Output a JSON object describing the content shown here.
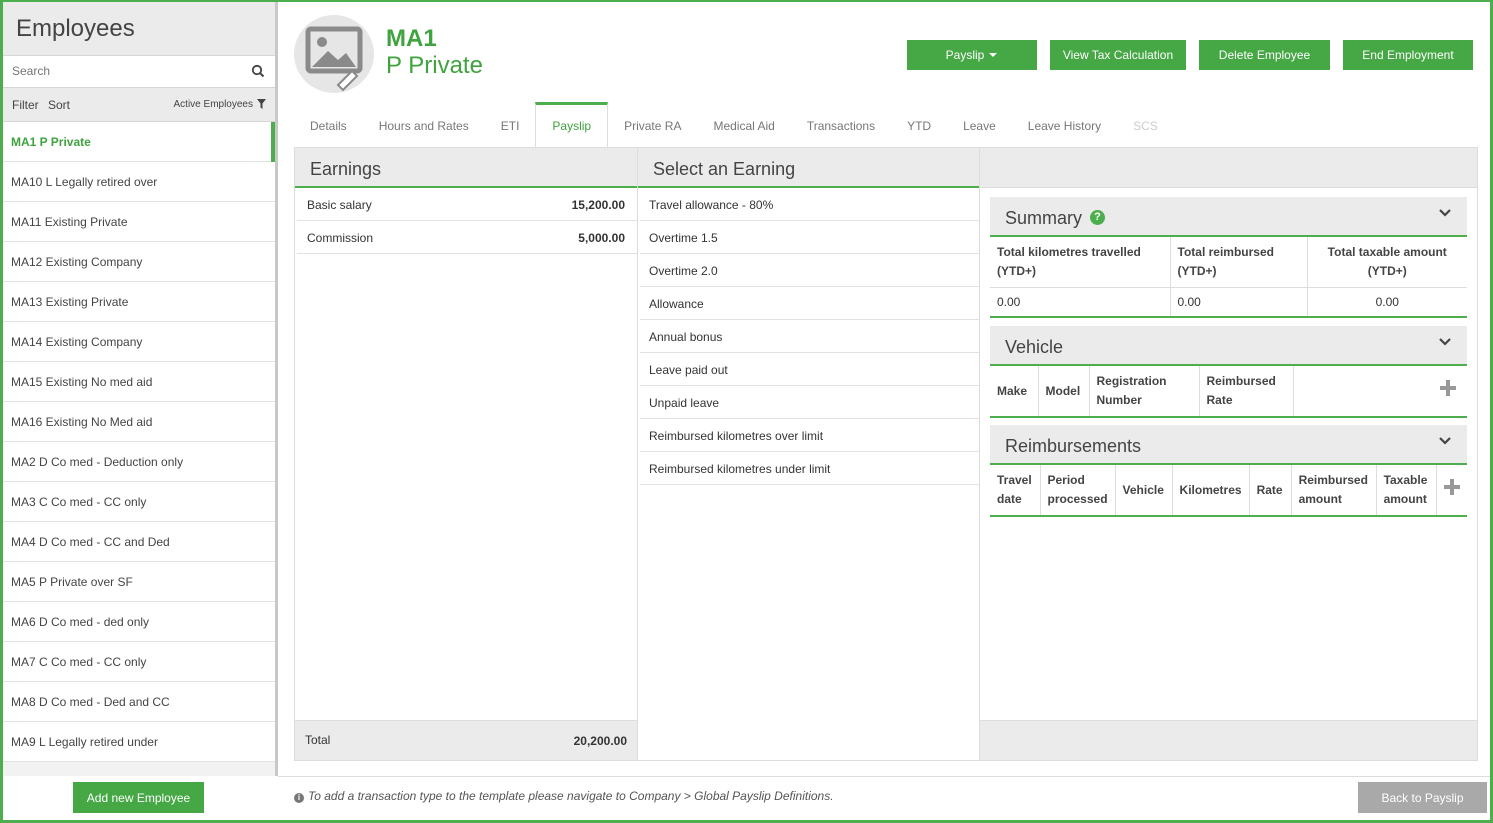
{
  "sidebar": {
    "title": "Employees",
    "search_placeholder": "Search",
    "filter_label": "Filter",
    "sort_label": "Sort",
    "active_filter": "Active Employees",
    "employees": [
      "MA1 P Private",
      "MA10 L Legally retired over",
      "MA11 Existing Private",
      "MA12 Existing Company",
      "MA13 Existing Private",
      "MA14 Existing Company",
      "MA15 Existing No med aid",
      "MA16 Existing No Med aid",
      "MA2 D Co med - Deduction only",
      "MA3 C Co med - CC only",
      "MA4 D Co med - CC and Ded",
      "MA5 P Private over SF",
      "MA6 D Co med - ded only",
      "MA7 C Co med - CC only",
      "MA8 D Co med - Ded and CC",
      "MA9 L Legally retired under"
    ],
    "add_button": "Add new Employee"
  },
  "header": {
    "code": "MA1",
    "name": "P Private",
    "buttons": {
      "payslip": "Payslip",
      "view_tax": "View Tax Calculation",
      "delete": "Delete Employee",
      "end": "End Employment"
    }
  },
  "tabs": [
    "Details",
    "Hours and Rates",
    "ETI",
    "Payslip",
    "Private RA",
    "Medical Aid",
    "Transactions",
    "YTD",
    "Leave",
    "Leave History",
    "SCS"
  ],
  "active_tab": "Payslip",
  "earnings": {
    "title": "Earnings",
    "rows": [
      {
        "label": "Basic salary",
        "value": "15,200.00"
      },
      {
        "label": "Commission",
        "value": "5,000.00"
      }
    ],
    "total_label": "Total",
    "total_value": "20,200.00"
  },
  "select_earning": {
    "title": "Select an Earning",
    "items": [
      "Travel allowance - 80%",
      "Overtime 1.5",
      "Overtime 2.0",
      "Allowance",
      "Annual bonus",
      "Leave paid out",
      "Unpaid leave",
      "Reimbursed kilometres over limit",
      "Reimbursed kilometres under limit"
    ]
  },
  "summary": {
    "title": "Summary",
    "col1": "Total kilometres travelled (YTD+)",
    "col2": "Total reimbursed (YTD+)",
    "col3": "Total taxable amount (YTD+)",
    "val1": "0.00",
    "val2": "0.00",
    "val3": "0.00"
  },
  "vehicle": {
    "title": "Vehicle",
    "make": "Make",
    "model": "Model",
    "reg": "Registration Number",
    "rate": "Reimbursed Rate"
  },
  "reimbursements": {
    "title": "Reimbursements",
    "travel_date": "Travel date",
    "period": "Period processed",
    "vehicle": "Vehicle",
    "km": "Kilometres",
    "rate": "Rate",
    "reimbursed": "Reimbursed amount",
    "taxable": "Taxable amount"
  },
  "footer": {
    "note": "To add a transaction type to the template please navigate to Company > Global Payslip Definitions.",
    "back_button": "Back to Payslip"
  },
  "colors": {
    "accent": "#4cae4c",
    "button_green": "#45a845",
    "disabled_button": "#a9a9a9"
  }
}
